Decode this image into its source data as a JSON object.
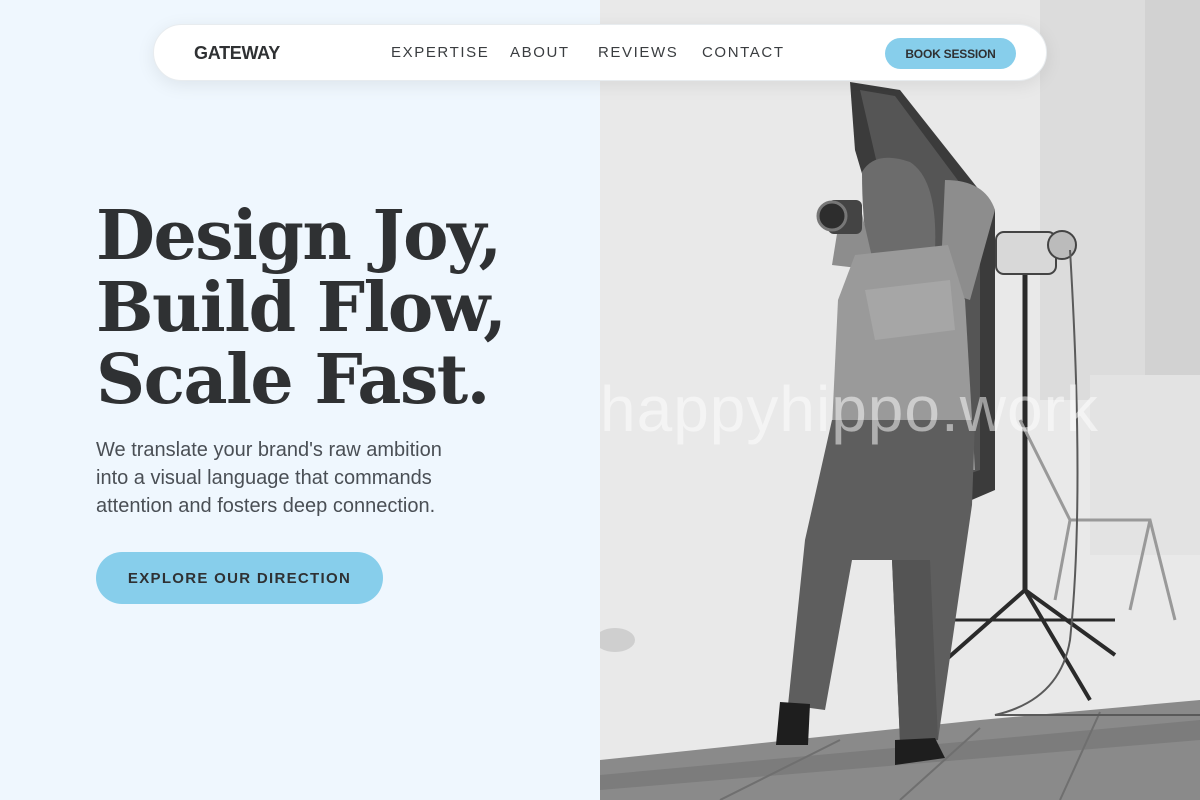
{
  "nav": {
    "logo": "GATEWAY",
    "links": [
      "EXPERTISE",
      "ABOUT",
      "REVIEWS",
      "CONTACT"
    ],
    "cta_label": "BOOK SESSION"
  },
  "hero": {
    "headline_lines": [
      "Design Joy,",
      "Build Flow,",
      "Scale Fast."
    ],
    "subtext_lines": [
      "We translate your brand's raw ambition",
      "into a visual language that commands",
      "attention and fosters deep connection."
    ],
    "cta_label": "EXPLORE OUR DIRECTION"
  },
  "photo": {
    "watermark": "happyhippo.work",
    "subject": "grayscale photo of a photographer with camera beside a softbox studio light"
  },
  "colors": {
    "background": "#eff7fe",
    "accent": "#87ceeb",
    "text_dark": "#2f3133"
  }
}
